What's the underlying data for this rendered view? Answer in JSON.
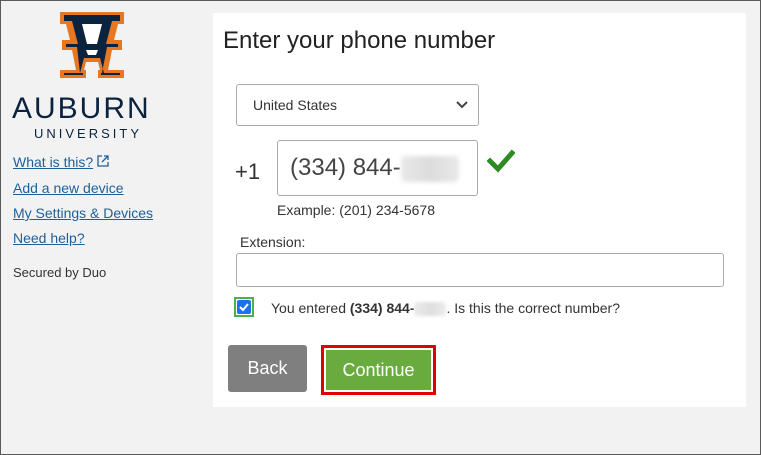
{
  "sidebar": {
    "wordmark": "AUBURN",
    "subwordmark": "UNIVERSITY",
    "links": [
      {
        "label": "What is this?",
        "icon": "external-link-icon"
      },
      {
        "label": "Add a new device"
      },
      {
        "label": "My Settings & Devices"
      },
      {
        "label": "Need help?"
      }
    ],
    "secured": "Secured by Duo"
  },
  "main": {
    "title": "Enter your phone number",
    "country": {
      "selected": "United States"
    },
    "country_code": "+1",
    "phone_value": "(334) 844-",
    "example": "Example: (201) 234-5678",
    "extension_label": "Extension:",
    "extension_value": "",
    "confirm": {
      "prefix": "You entered ",
      "number": "(334) 844-",
      "suffix": ". Is this the correct number?",
      "checked": true
    },
    "back_label": "Back",
    "continue_label": "Continue"
  },
  "colors": {
    "brand_navy": "#0c2340",
    "brand_orange": "#e87722",
    "link": "#1f5f99",
    "continue": "#6aab3f",
    "back": "#7f7f7f",
    "highlight": "#e00000",
    "check": "#2e8b22"
  }
}
